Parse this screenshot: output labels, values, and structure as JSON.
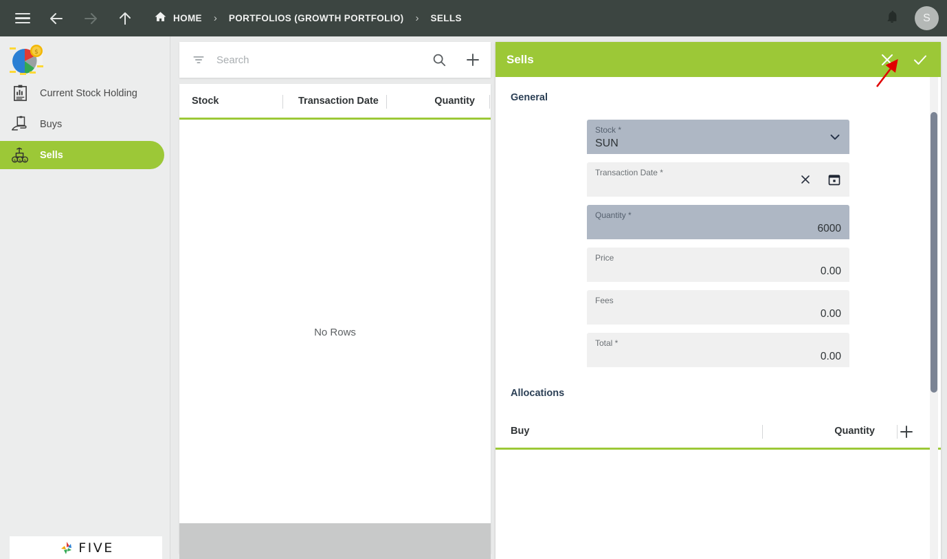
{
  "topbar": {
    "menu_icon": "hamburger-icon",
    "back_icon": "arrow-left-icon",
    "forward_icon": "arrow-right-icon",
    "up_icon": "arrow-up-icon",
    "home_icon": "home-icon",
    "home_label": "HOME",
    "separator": "›",
    "breadcrumb": [
      {
        "label": "PORTFOLIOS (GROWTH PORTFOLIO)"
      },
      {
        "label": "SELLS"
      }
    ],
    "bell_icon": "bell-icon",
    "avatar_initial": "S",
    "background_color": "#3c4541"
  },
  "sidebar": {
    "logo_icon": "pie-chart-coin-logo",
    "items": [
      {
        "label": "Current Stock Holding",
        "icon": "clipboard-chart-icon",
        "active": false
      },
      {
        "label": "Buys",
        "icon": "hand-clipboard-icon",
        "active": false
      },
      {
        "label": "Sells",
        "icon": "money-stack-icon",
        "active": true
      }
    ],
    "footer_logo_text": "FIVE",
    "active_color": "#9cc837"
  },
  "list_panel": {
    "search": {
      "placeholder": "Search",
      "value": "",
      "filter_icon": "filter-icon",
      "search_icon": "search-icon",
      "add_icon": "plus-icon"
    },
    "columns": [
      {
        "label": "Stock"
      },
      {
        "label": "Transaction Date"
      },
      {
        "label": "Quantity"
      }
    ],
    "empty_message": "No Rows",
    "accent_color": "#9cc837"
  },
  "form_panel": {
    "title": "Sells",
    "close_icon": "close-icon",
    "confirm_icon": "check-icon",
    "header_color": "#9cc837",
    "general_section": {
      "title": "General",
      "fields": [
        {
          "label": "Stock *",
          "value": "SUN",
          "align": "left",
          "selected": true,
          "icon": "chevron-down-icon"
        },
        {
          "label": "Transaction Date *",
          "value": "",
          "align": "right",
          "selected": false,
          "icon": "clear-and-calendar-icon"
        },
        {
          "label": "Quantity *",
          "value": "6000",
          "align": "right",
          "selected": true,
          "icon": ""
        },
        {
          "label": "Price",
          "value": "0.00",
          "align": "right",
          "selected": false,
          "icon": ""
        },
        {
          "label": "Fees",
          "value": "0.00",
          "align": "right",
          "selected": false,
          "icon": ""
        },
        {
          "label": "Total *",
          "value": "0.00",
          "align": "right",
          "selected": false,
          "icon": ""
        }
      ]
    },
    "allocations_section": {
      "title": "Allocations",
      "columns": [
        {
          "label": "Buy"
        },
        {
          "label": "Quantity"
        }
      ],
      "add_icon": "plus-icon"
    }
  },
  "annotation": {
    "arrow_color": "#e00000",
    "points_at": "close-icon"
  }
}
